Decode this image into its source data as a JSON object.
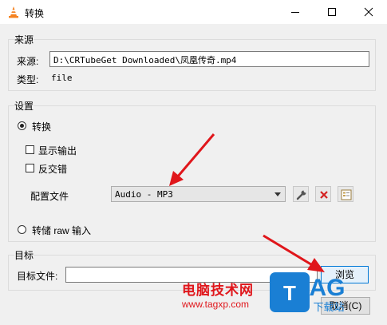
{
  "window": {
    "title": "转换",
    "app_icon": "vlc-cone-icon",
    "controls": [
      "minimize-icon",
      "maximize-icon",
      "close-icon"
    ]
  },
  "source": {
    "group_title": "来源",
    "source_label": "来源:",
    "source_value": "D:\\CRTubeGet Downloaded\\凤凰传奇.mp4",
    "type_label": "类型:",
    "type_value": "file"
  },
  "settings": {
    "group_title": "设置",
    "convert_label": "转换",
    "convert_checked": true,
    "show_output_label": "显示输出",
    "show_output_checked": false,
    "deinterlace_label": "反交错",
    "deinterlace_checked": false,
    "profile_label": "配置文件",
    "profile_value": "Audio - MP3",
    "profile_tools": [
      "wrench-icon",
      "delete-x-icon",
      "list-profile-icon"
    ],
    "dump_raw_label": "转储 raw 输入",
    "dump_raw_checked": false
  },
  "target": {
    "group_title": "目标",
    "file_label": "目标文件:",
    "file_value": "",
    "browse_label": "浏览",
    "cancel_label": "取消(C)"
  },
  "watermark": {
    "site_name": "电脑技术网",
    "site_url": "www.tagxp.com",
    "logo_text": "TAG",
    "logo_sub": "下载站"
  },
  "annotations": {
    "arrow_color": "#e0161b"
  }
}
